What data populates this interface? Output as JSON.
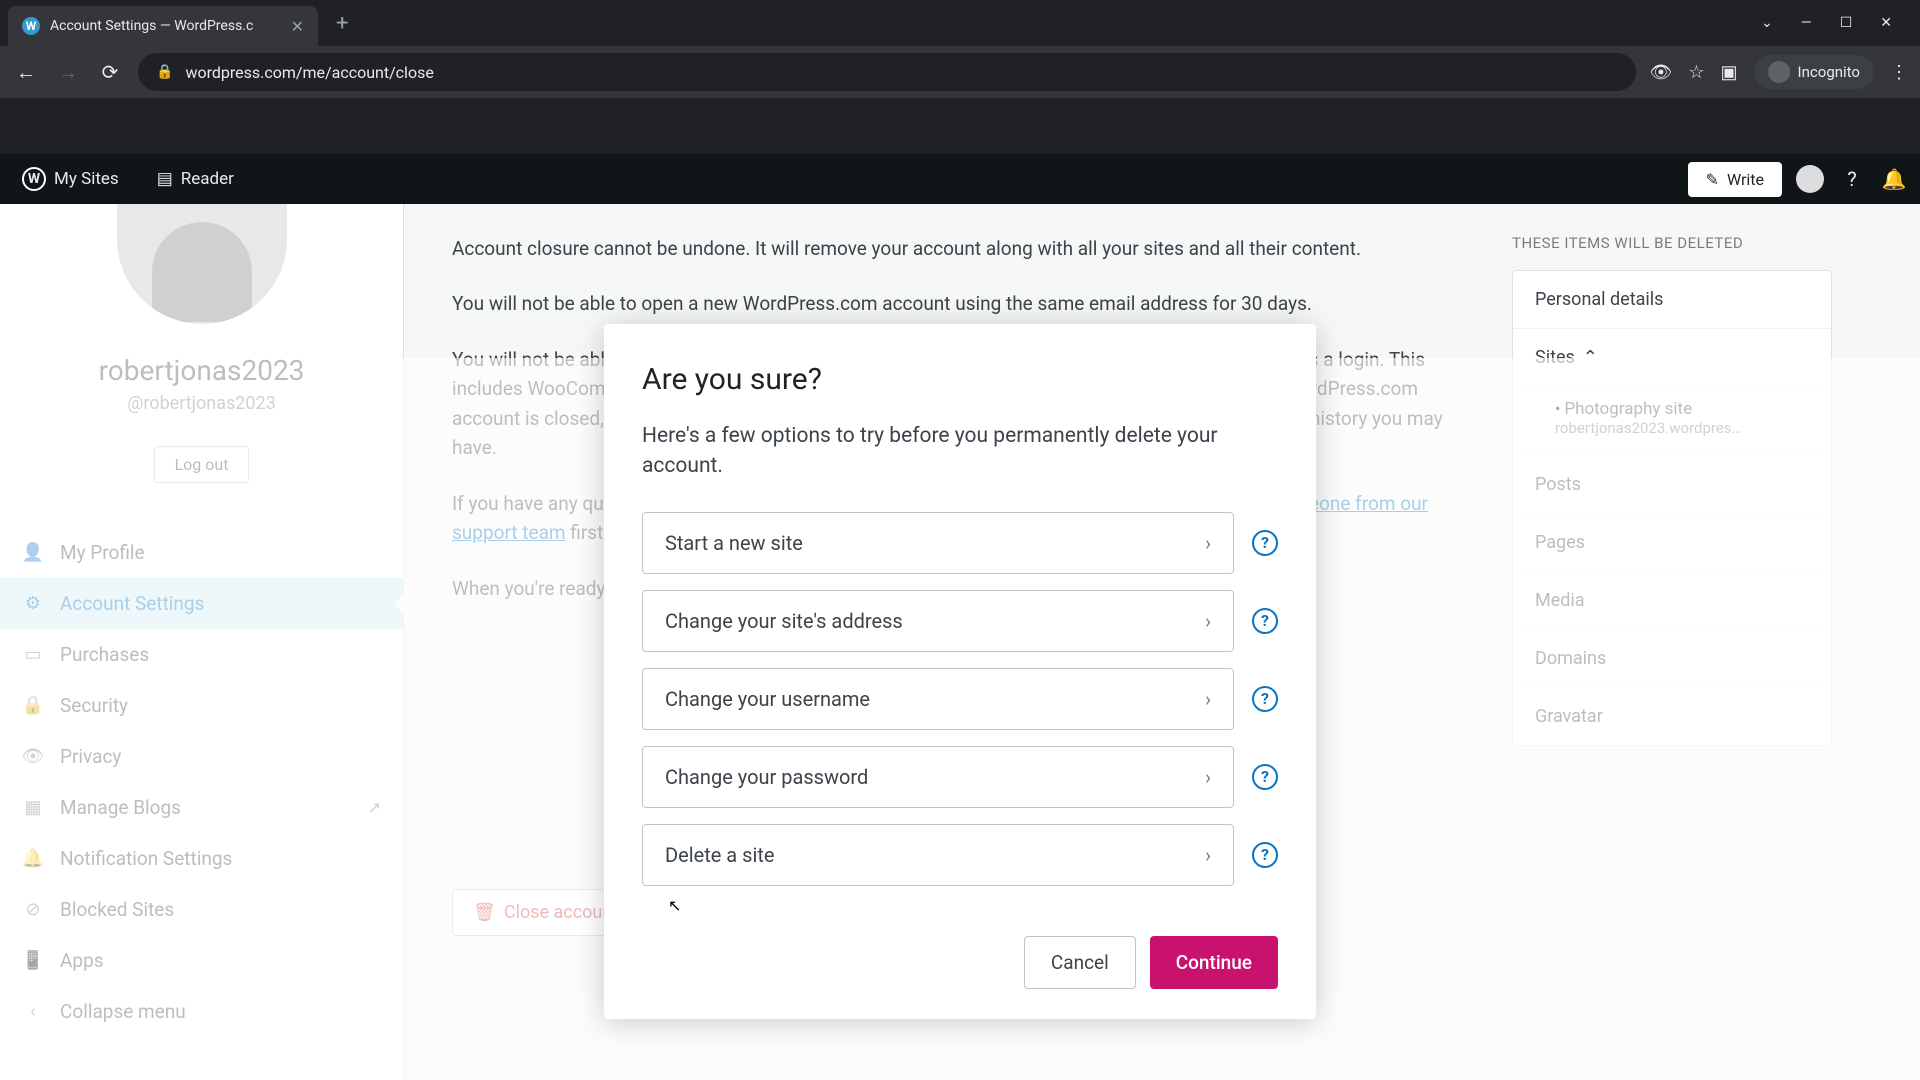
{
  "browser": {
    "tab_title": "Account Settings — WordPress.c",
    "url": "wordpress.com/me/account/close",
    "incognito_label": "Incognito",
    "window_controls": {
      "min": "—",
      "max": "☐",
      "close": "✕"
    }
  },
  "masterbar": {
    "my_sites": "My Sites",
    "reader": "Reader",
    "write": "Write"
  },
  "profile": {
    "display_name": "robertjonas2023",
    "handle": "@robertjonas2023",
    "logout": "Log out"
  },
  "nav": {
    "my_profile": "My Profile",
    "account_settings": "Account Settings",
    "purchases": "Purchases",
    "security": "Security",
    "privacy": "Privacy",
    "manage_blogs": "Manage Blogs",
    "notification_settings": "Notification Settings",
    "blocked_sites": "Blocked Sites",
    "apps": "Apps",
    "collapse": "Collapse menu"
  },
  "content": {
    "p1": "Account closure cannot be undone. It will remove your account along with all your sites and all their content.",
    "p2": "You will not be able to open a new WordPress.com account using the same email address for 30 days.",
    "p3a": "You will not be able to log in to any other Automattic Services that use your WordPress.com account as a login. This includes WooCommerce.com, Crowdsignal.com, IntenseDebate.com and Gravatar.com. Once your WordPress.com account is closed, these services will also be closed and you will lose access to any orders or support history you may have.",
    "p4a": "If you have any questions at all about what happens when you close an account, please ",
    "p4link": "chat with someone from our support team",
    "p4b": " first. They'll explain the ramifications and help you explore alternatives.",
    "p5": "When you're ready to proceed, use the \"Close account\" button.",
    "close_btn": "Close account"
  },
  "right": {
    "heading": "THESE ITEMS WILL BE DELETED",
    "personal": "Personal details",
    "sites": "Sites",
    "site_name": "Photography site",
    "site_url": "robertjonas2023.wordpres…",
    "posts": "Posts",
    "pages": "Pages",
    "media": "Media",
    "domains": "Domains",
    "gravatar": "Gravatar"
  },
  "modal": {
    "title": "Are you sure?",
    "subtitle": "Here's a few options to try before you permanently delete your account.",
    "options": {
      "new_site": "Start a new site",
      "change_address": "Change your site's address",
      "change_username": "Change your username",
      "change_password": "Change your password",
      "delete_site": "Delete a site"
    },
    "cancel": "Cancel",
    "continue": "Continue"
  }
}
